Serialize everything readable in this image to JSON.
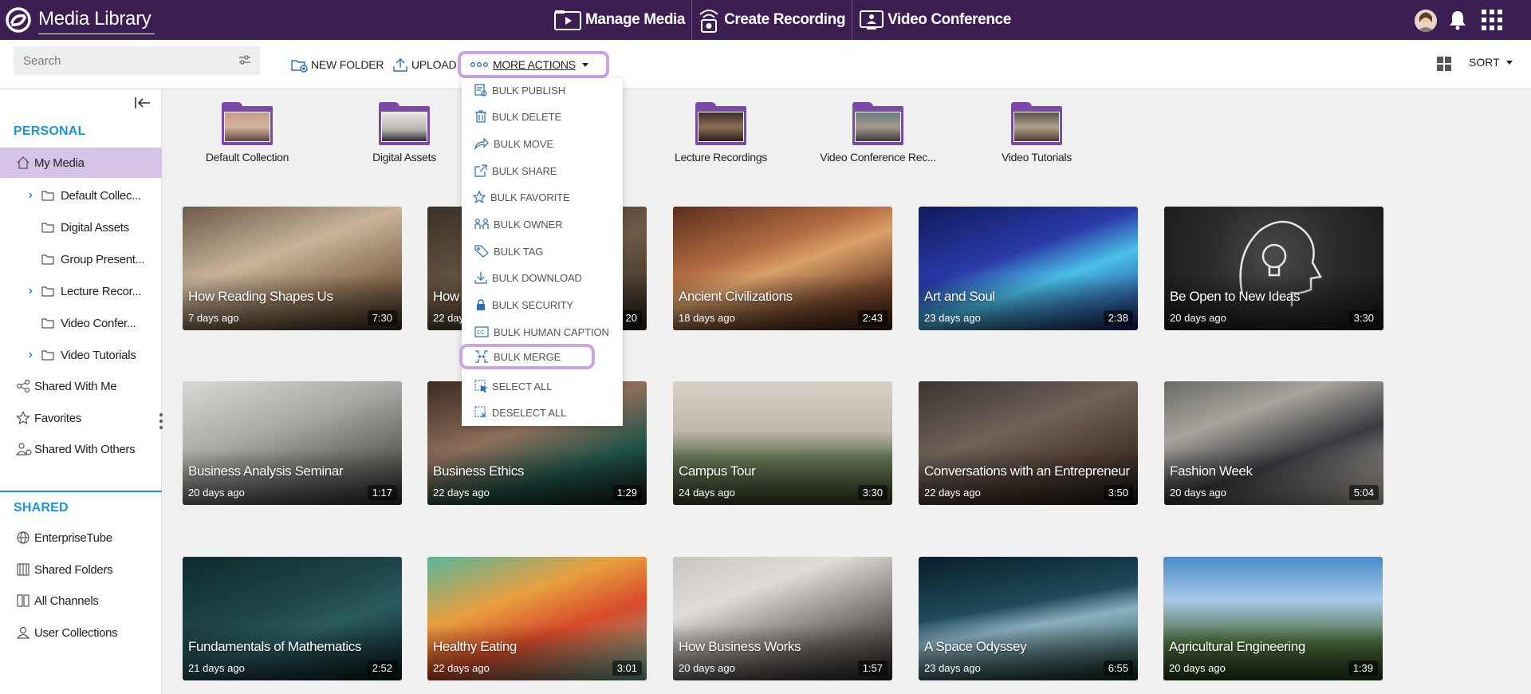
{
  "app": {
    "title": "Media Library"
  },
  "topnav": [
    {
      "label": "Manage Media",
      "icon": "play-folder-icon"
    },
    {
      "label": "Create Recording",
      "icon": "recording-icon"
    },
    {
      "label": "Video Conference",
      "icon": "video-conference-icon"
    }
  ],
  "toolbar": {
    "search_placeholder": "Search",
    "new_folder": "NEW FOLDER",
    "upload": "UPLOAD",
    "more_actions": "MORE ACTIONS",
    "sort": "SORT"
  },
  "sidebar": {
    "personal_heading": "PERSONAL",
    "my_media": "My Media",
    "folders": [
      {
        "label": "Default Collec...",
        "expandable": true
      },
      {
        "label": "Digital Assets",
        "expandable": false
      },
      {
        "label": "Group Present...",
        "expandable": false
      },
      {
        "label": "Lecture Recor...",
        "expandable": true
      },
      {
        "label": "Video Confer...",
        "expandable": false
      },
      {
        "label": "Video Tutorials",
        "expandable": true
      }
    ],
    "shared_with_me": "Shared With Me",
    "favorites": "Favorites",
    "shared_with_others": "Shared With Others",
    "shared_heading": "SHARED",
    "shared_items": [
      {
        "label": "EnterpriseTube",
        "icon": "globe-icon"
      },
      {
        "label": "Shared Folders",
        "icon": "shared-folders-icon"
      },
      {
        "label": "All Channels",
        "icon": "channels-icon"
      },
      {
        "label": "User Collections",
        "icon": "user-collections-icon"
      }
    ]
  },
  "folders": [
    {
      "label": "Default Collection"
    },
    {
      "label": "Digital Assets"
    },
    {
      "label": "Lecture Recordings"
    },
    {
      "label": "Video Conference Rec..."
    },
    {
      "label": "Video Tutorials"
    }
  ],
  "more_menu": [
    {
      "label": "BULK PUBLISH",
      "icon": "publish-icon"
    },
    {
      "label": "BULK DELETE",
      "icon": "trash-icon"
    },
    {
      "label": "BULK MOVE",
      "icon": "move-arrow-icon"
    },
    {
      "label": "BULK SHARE",
      "icon": "share-icon"
    },
    {
      "label": "BULK FAVORITE",
      "icon": "star-icon"
    },
    {
      "label": "BULK OWNER",
      "icon": "owner-icon"
    },
    {
      "label": "BULK TAG",
      "icon": "tag-icon"
    },
    {
      "label": "BULK DOWNLOAD",
      "icon": "download-icon"
    },
    {
      "label": "BULK SECURITY",
      "icon": "lock-icon"
    },
    {
      "label": "BULK HUMAN CAPTION",
      "icon": "caption-icon"
    },
    {
      "label": "BULK MERGE",
      "icon": "merge-icon"
    },
    {
      "label": "SELECT ALL",
      "icon": "select-all-icon"
    },
    {
      "label": "DESELECT ALL",
      "icon": "deselect-all-icon"
    }
  ],
  "media": [
    {
      "title": "How Reading Shapes Us",
      "age": "7 days ago",
      "duration": "7:30"
    },
    {
      "title": "How",
      "age": "22 days ago",
      "duration": "20"
    },
    {
      "title": "Ancient Civilizations",
      "age": "18 days ago",
      "duration": "2:43"
    },
    {
      "title": "Art and Soul",
      "age": "23 days ago",
      "duration": "2:38"
    },
    {
      "title": "Be Open to New Ideas",
      "age": "20 days ago",
      "duration": "3:30"
    },
    {
      "title": "Business Analysis Seminar",
      "age": "20 days ago",
      "duration": "1:17"
    },
    {
      "title": "Business Ethics",
      "age": "22 days ago",
      "duration": "1:29"
    },
    {
      "title": "Campus Tour",
      "age": "24 days ago",
      "duration": "3:30"
    },
    {
      "title": "Conversations with an Entrepreneur",
      "age": "22 days ago",
      "duration": "3:50"
    },
    {
      "title": "Fashion Week",
      "age": "20 days ago",
      "duration": "5:04"
    },
    {
      "title": "Fundamentals of Mathematics",
      "age": "21 days ago",
      "duration": "2:52"
    },
    {
      "title": "Healthy Eating",
      "age": "22 days ago",
      "duration": "3:01"
    },
    {
      "title": "How Business Works",
      "age": "20 days ago",
      "duration": "1:57"
    },
    {
      "title": "A Space Odyssey",
      "age": "23 days ago",
      "duration": "6:55"
    },
    {
      "title": "Agricultural Engineering",
      "age": "20 days ago",
      "duration": "1:39"
    }
  ],
  "colors": {
    "header": "#3d1e52",
    "accent_blue": "#1c95d4",
    "active_item": "#d6c3e8",
    "highlight_ring": "#c9a5e3",
    "folder": "#7b4aa6"
  }
}
